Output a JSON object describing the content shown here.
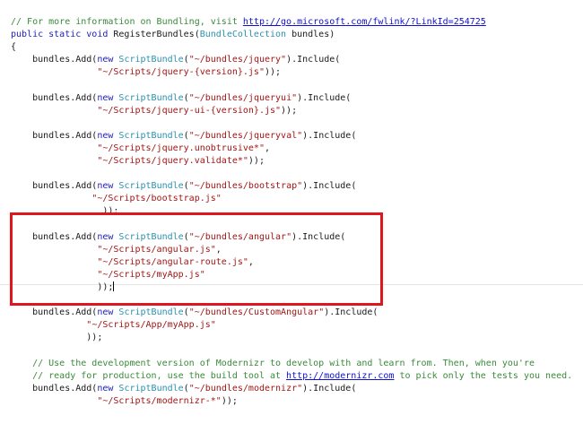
{
  "editor": {
    "lines": [
      [
        [
          "comment",
          "// For more information on Bundling, visit "
        ],
        [
          "link",
          "http://go.microsoft.com/fwlink/?LinkId=254725"
        ]
      ],
      [
        [
          "kw",
          "public static void "
        ],
        [
          "plain",
          "RegisterBundles("
        ],
        [
          "type",
          "BundleCollection"
        ],
        [
          "plain",
          " bundles)"
        ]
      ],
      [
        [
          "plain",
          "{"
        ]
      ],
      [
        [
          "plain",
          "    bundles.Add("
        ],
        [
          "kw",
          "new "
        ],
        [
          "type",
          "ScriptBundle"
        ],
        [
          "plain",
          "("
        ],
        [
          "str",
          "\"~/bundles/jquery\""
        ],
        [
          "plain",
          ").Include("
        ]
      ],
      [
        [
          "plain",
          "                "
        ],
        [
          "str",
          "\"~/Scripts/jquery-{version}.js\""
        ],
        [
          "plain",
          "));"
        ]
      ],
      [],
      [
        [
          "plain",
          "    bundles.Add("
        ],
        [
          "kw",
          "new "
        ],
        [
          "type",
          "ScriptBundle"
        ],
        [
          "plain",
          "("
        ],
        [
          "str",
          "\"~/bundles/jqueryui\""
        ],
        [
          "plain",
          ").Include("
        ]
      ],
      [
        [
          "plain",
          "                "
        ],
        [
          "str",
          "\"~/Scripts/jquery-ui-{version}.js\""
        ],
        [
          "plain",
          "));"
        ]
      ],
      [],
      [
        [
          "plain",
          "    bundles.Add("
        ],
        [
          "kw",
          "new "
        ],
        [
          "type",
          "ScriptBundle"
        ],
        [
          "plain",
          "("
        ],
        [
          "str",
          "\"~/bundles/jqueryval\""
        ],
        [
          "plain",
          ").Include("
        ]
      ],
      [
        [
          "plain",
          "                "
        ],
        [
          "str",
          "\"~/Scripts/jquery.unobtrusive*\""
        ],
        [
          "plain",
          ","
        ]
      ],
      [
        [
          "plain",
          "                "
        ],
        [
          "str",
          "\"~/Scripts/jquery.validate*\""
        ],
        [
          "plain",
          "));"
        ]
      ],
      [],
      [
        [
          "plain",
          "    bundles.Add("
        ],
        [
          "kw",
          "new "
        ],
        [
          "type",
          "ScriptBundle"
        ],
        [
          "plain",
          "("
        ],
        [
          "str",
          "\"~/bundles/bootstrap\""
        ],
        [
          "plain",
          ").Include("
        ]
      ],
      [
        [
          "plain",
          "               "
        ],
        [
          "str",
          "\"~/Scripts/bootstrap.js\""
        ]
      ],
      [
        [
          "plain",
          "                 ));"
        ]
      ],
      [],
      [
        [
          "plain",
          "    bundles.Add("
        ],
        [
          "kw",
          "new "
        ],
        [
          "type",
          "ScriptBundle"
        ],
        [
          "plain",
          "("
        ],
        [
          "str",
          "\"~/bundles/angular\""
        ],
        [
          "plain",
          ").Include("
        ]
      ],
      [
        [
          "plain",
          "                "
        ],
        [
          "str",
          "\"~/Scripts/angular.js\""
        ],
        [
          "plain",
          ","
        ]
      ],
      [
        [
          "plain",
          "                "
        ],
        [
          "str",
          "\"~/Scripts/angular-route.js\""
        ],
        [
          "plain",
          ","
        ]
      ],
      [
        [
          "plain",
          "                "
        ],
        [
          "str",
          "\"~/Scripts/myApp.js\""
        ]
      ],
      [
        [
          "plain",
          "                ));"
        ],
        [
          "caret",
          ""
        ]
      ],
      [],
      [
        [
          "plain",
          "    bundles.Add("
        ],
        [
          "kw",
          "new "
        ],
        [
          "type",
          "ScriptBundle"
        ],
        [
          "plain",
          "("
        ],
        [
          "str",
          "\"~/bundles/CustomAngular\""
        ],
        [
          "plain",
          ").Include("
        ]
      ],
      [
        [
          "plain",
          "              "
        ],
        [
          "str",
          "\"~/Scripts/App/myApp.js\""
        ]
      ],
      [
        [
          "plain",
          "              ));"
        ]
      ],
      [],
      [
        [
          "comment",
          "    // Use the development version of Modernizr to develop with and learn from. Then, when you're"
        ]
      ],
      [
        [
          "comment",
          "    // ready for production, use the build tool at "
        ],
        [
          "link",
          "http://modernizr.com"
        ],
        [
          "comment",
          " to pick only the tests you need."
        ]
      ],
      [
        [
          "plain",
          "    bundles.Add("
        ],
        [
          "kw",
          "new "
        ],
        [
          "type",
          "ScriptBundle"
        ],
        [
          "plain",
          "("
        ],
        [
          "str",
          "\"~/bundles/modernizr\""
        ],
        [
          "plain",
          ").Include("
        ]
      ],
      [
        [
          "plain",
          "                "
        ],
        [
          "str",
          "\"~/Scripts/modernizr-*\""
        ],
        [
          "plain",
          "));"
        ]
      ]
    ]
  },
  "colors": {
    "highlight_box": "#e0161e",
    "comment": "#3a8a3a",
    "keyword": "#2020c0",
    "type": "#2b91af",
    "string": "#a31515"
  }
}
